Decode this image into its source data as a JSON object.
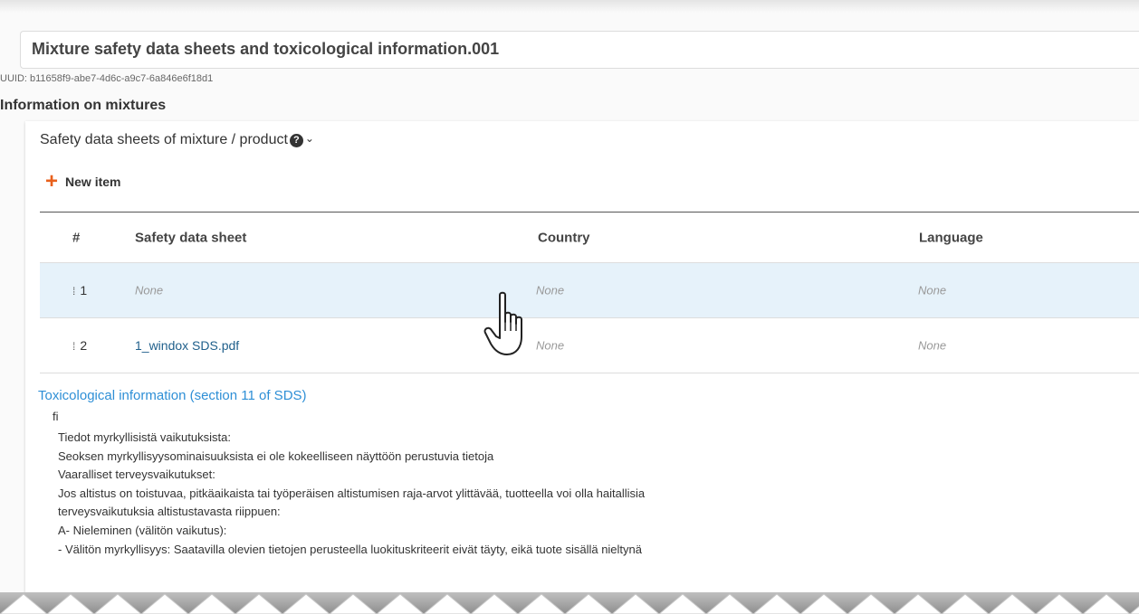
{
  "header": {
    "title": "Mixture safety data sheets and toxicological information.001",
    "uuid": "UUID: b11658f9-abe7-4d6c-a9c7-6a846e6f18d1"
  },
  "section": {
    "title": "Information on mixtures",
    "subsection_title": "Safety data sheets of mixture / product",
    "help_glyph": "?",
    "chevron_glyph": "⌄",
    "new_item_label": "New item",
    "plus_glyph": "+"
  },
  "table": {
    "headers": {
      "num": "#",
      "sds": "Safety data sheet",
      "country": "Country",
      "language": "Language"
    },
    "rows": [
      {
        "num": "1",
        "sds": "None",
        "country": "None",
        "language": "None",
        "drag": "⁞"
      },
      {
        "num": "2",
        "sds": "1_windox SDS.pdf",
        "country": "None",
        "language": "None",
        "drag": "⁞"
      }
    ]
  },
  "tox": {
    "title": "Toxicological information (section 11 of SDS)",
    "lang": "fi",
    "lines": [
      "Tiedot myrkyllisistä vaikutuksista:",
      "Seoksen myrkyllisyysominaisuuksista ei ole kokeelliseen näyttöön perustuvia tietoja",
      "Vaaralliset terveysvaikutukset:",
      "Jos altistus on toistuvaa, pitkäaikaista tai työperäisen altistumisen raja-arvot ylittävää, tuotteella voi olla haitallisia",
      "terveysvaikutuksia altistustavasta riippuen:",
      "A- Nieleminen (välitön vaikutus):",
      "- Välitön myrkyllisyys: Saatavilla olevien tietojen perusteella luokituskriteerit eivät täyty, eikä tuote sisällä nieltynä"
    ]
  },
  "icons": {
    "help": "help-circle-icon",
    "chevron": "chevron-down-icon",
    "plus": "plus-icon",
    "drag": "drag-handle-icon",
    "cursor": "hand-pointer-icon"
  },
  "colors": {
    "accent_orange": "#e8601c",
    "link_blue": "#1f5f8b",
    "section_blue": "#2e8fd6",
    "row_highlight": "#e6f2fa"
  }
}
